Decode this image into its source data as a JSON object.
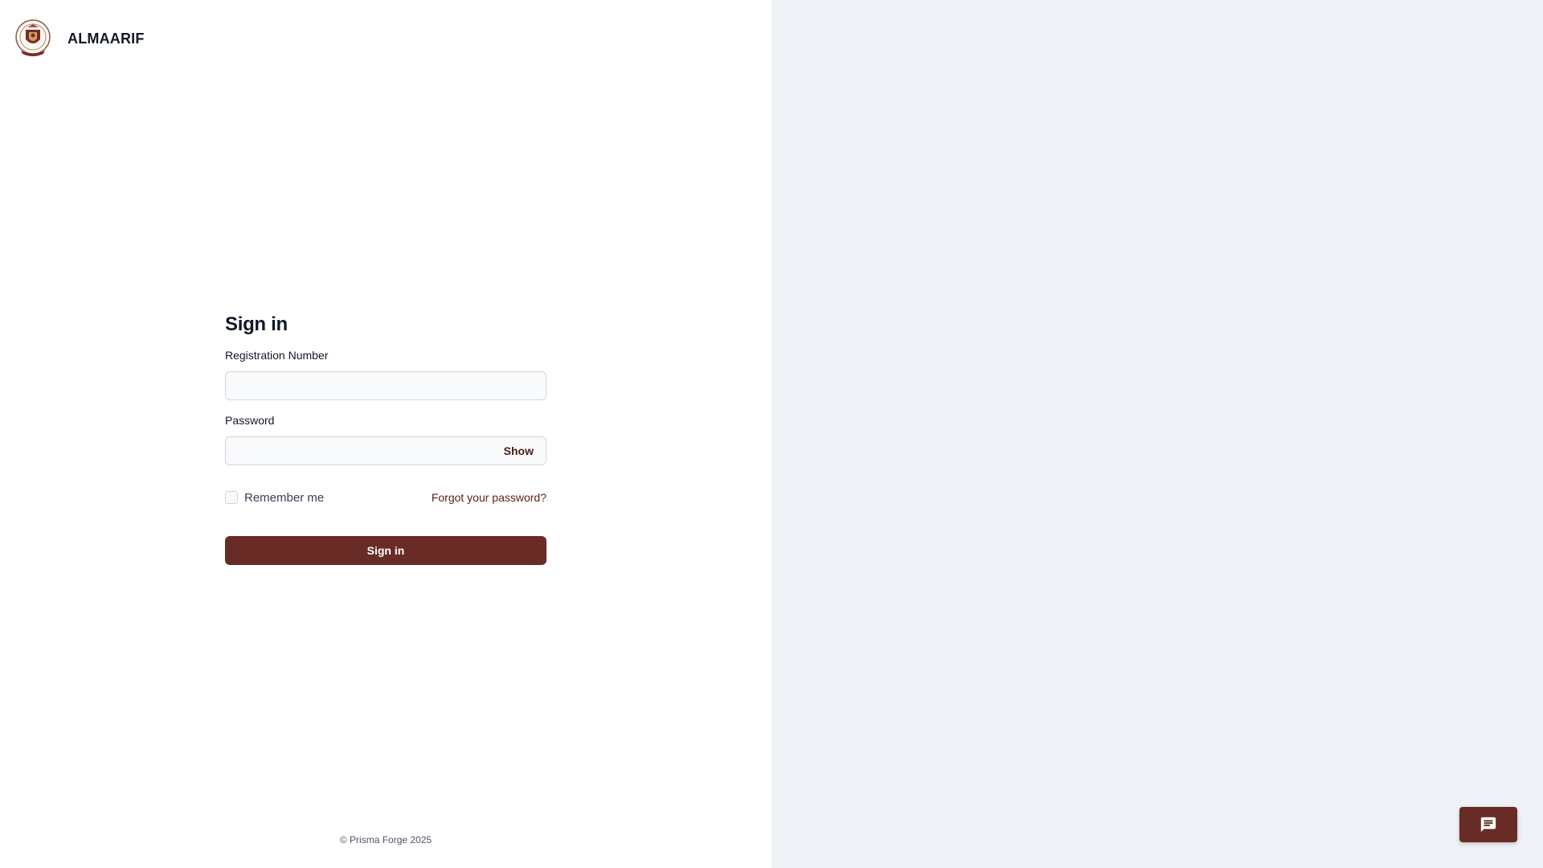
{
  "brand": {
    "name": "ALMAARIF",
    "logo_icon": "university-crest-icon"
  },
  "signin": {
    "title": "Sign in",
    "registration_label": "Registration Number",
    "registration_value": "",
    "password_label": "Password",
    "password_value": "",
    "show_label": "Show",
    "remember_label": "Remember me",
    "remember_checked": false,
    "forgot_label": "Forgot your password?",
    "submit_label": "Sign in"
  },
  "footer": {
    "copyright": "© Prisma Forge 2025"
  },
  "chat": {
    "icon": "chat-bubble-icon"
  },
  "colors": {
    "primary": "#682b25",
    "link": "#5b2019",
    "right_panel": "#eff2f7"
  }
}
